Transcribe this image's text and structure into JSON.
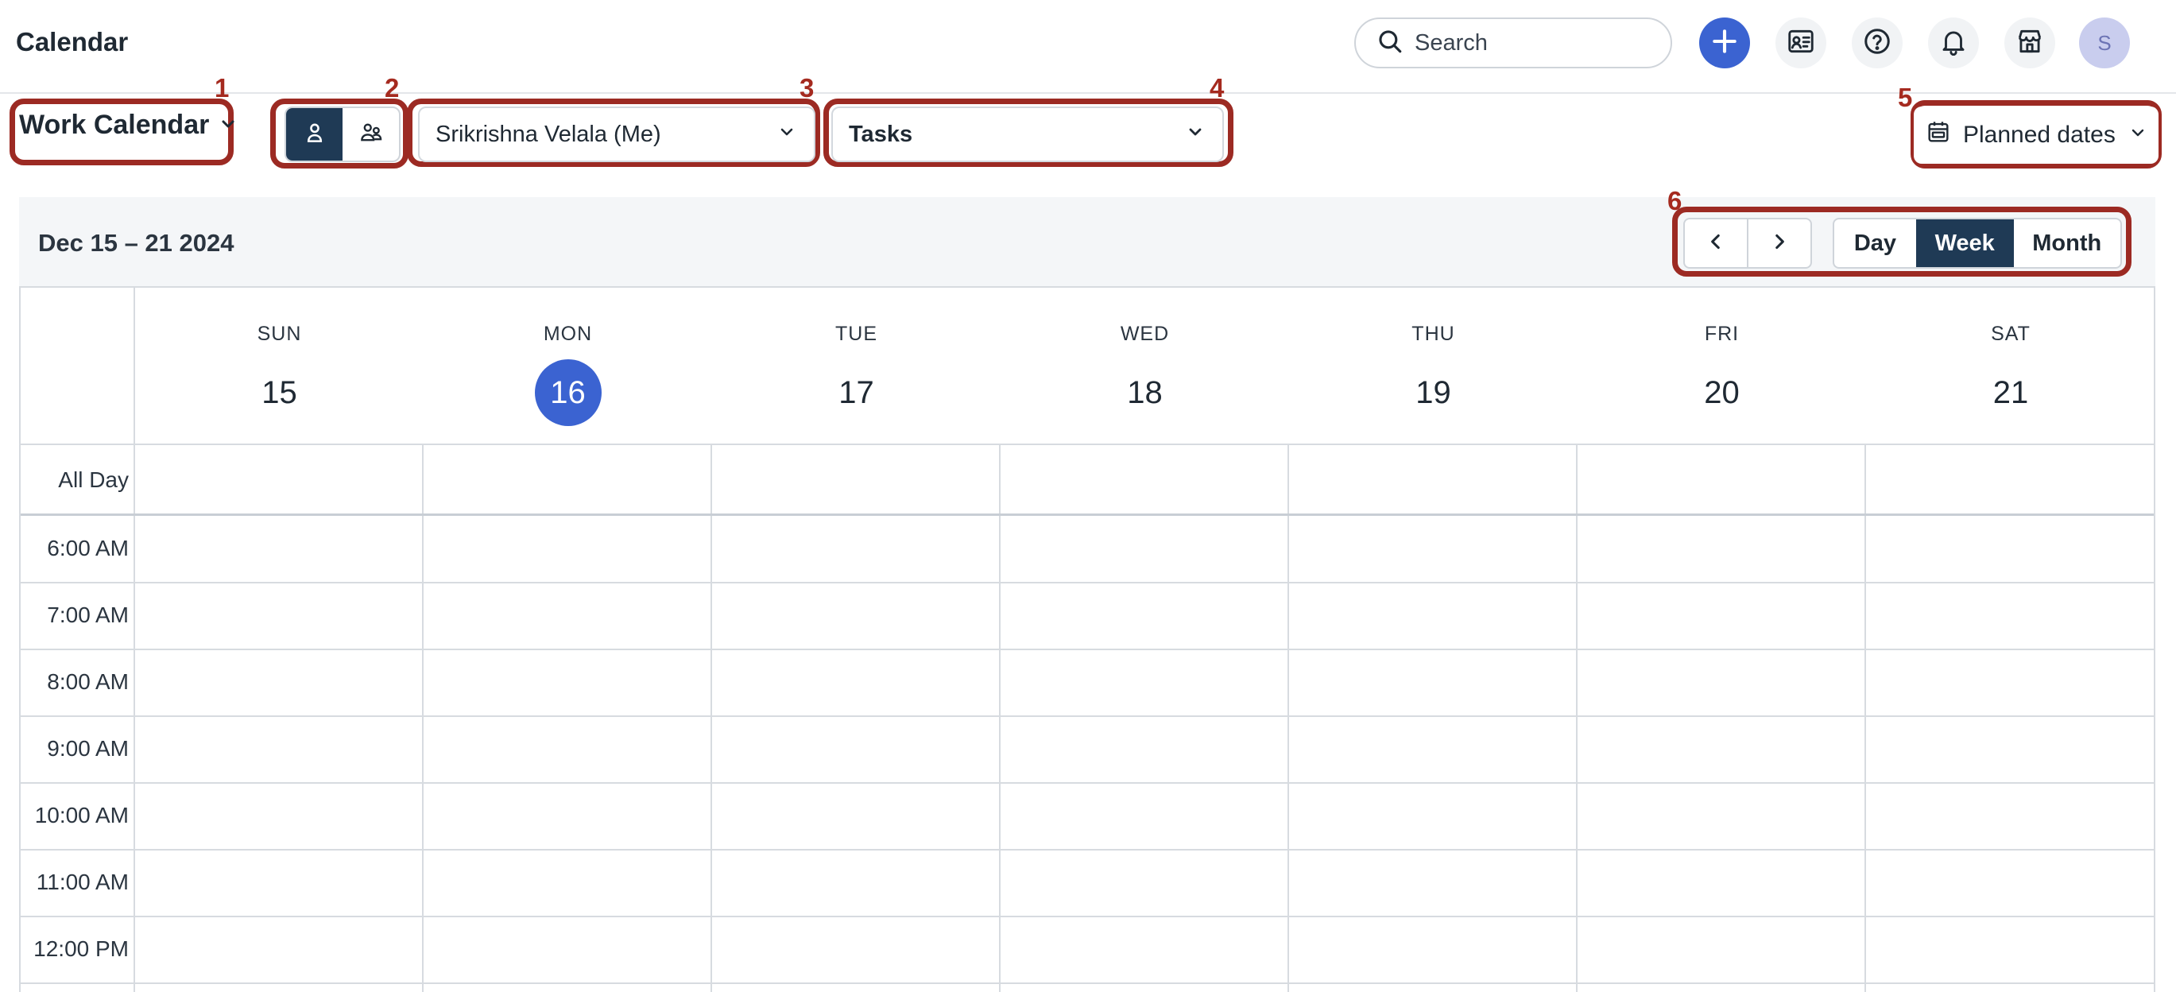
{
  "header": {
    "title": "Calendar",
    "search_placeholder": "Search",
    "avatar_initial": "S",
    "icons": [
      "search-icon",
      "plus-icon",
      "contact-card-icon",
      "help-icon",
      "bell-icon",
      "store-icon"
    ]
  },
  "toolbar": {
    "calendar_select": "Work Calendar",
    "user_select": "Srikrishna Velala (Me)",
    "type_select": "Tasks",
    "dates_select": "Planned dates",
    "view_mode_toggle": [
      "single-user-icon",
      "team-icon"
    ],
    "view_mode_active": "single-user"
  },
  "annotations": [
    "1",
    "2",
    "3",
    "4",
    "5",
    "6"
  ],
  "calendar": {
    "range_title": "Dec 15 – 21 2024",
    "views": [
      "Day",
      "Week",
      "Month"
    ],
    "active_view": "Week",
    "days": [
      {
        "name": "SUN",
        "date": "15"
      },
      {
        "name": "MON",
        "date": "16",
        "today": true
      },
      {
        "name": "TUE",
        "date": "17"
      },
      {
        "name": "WED",
        "date": "18"
      },
      {
        "name": "THU",
        "date": "19"
      },
      {
        "name": "FRI",
        "date": "20"
      },
      {
        "name": "SAT",
        "date": "21"
      }
    ],
    "all_day_label": "All Day",
    "time_slots": [
      "6:00 AM",
      "7:00 AM",
      "8:00 AM",
      "9:00 AM",
      "10:00 AM",
      "11:00 AM",
      "12:00 PM"
    ]
  },
  "colors": {
    "accent": "#3b63d1",
    "active_segment": "#1f3a55",
    "annotation": "#9c2a23"
  }
}
